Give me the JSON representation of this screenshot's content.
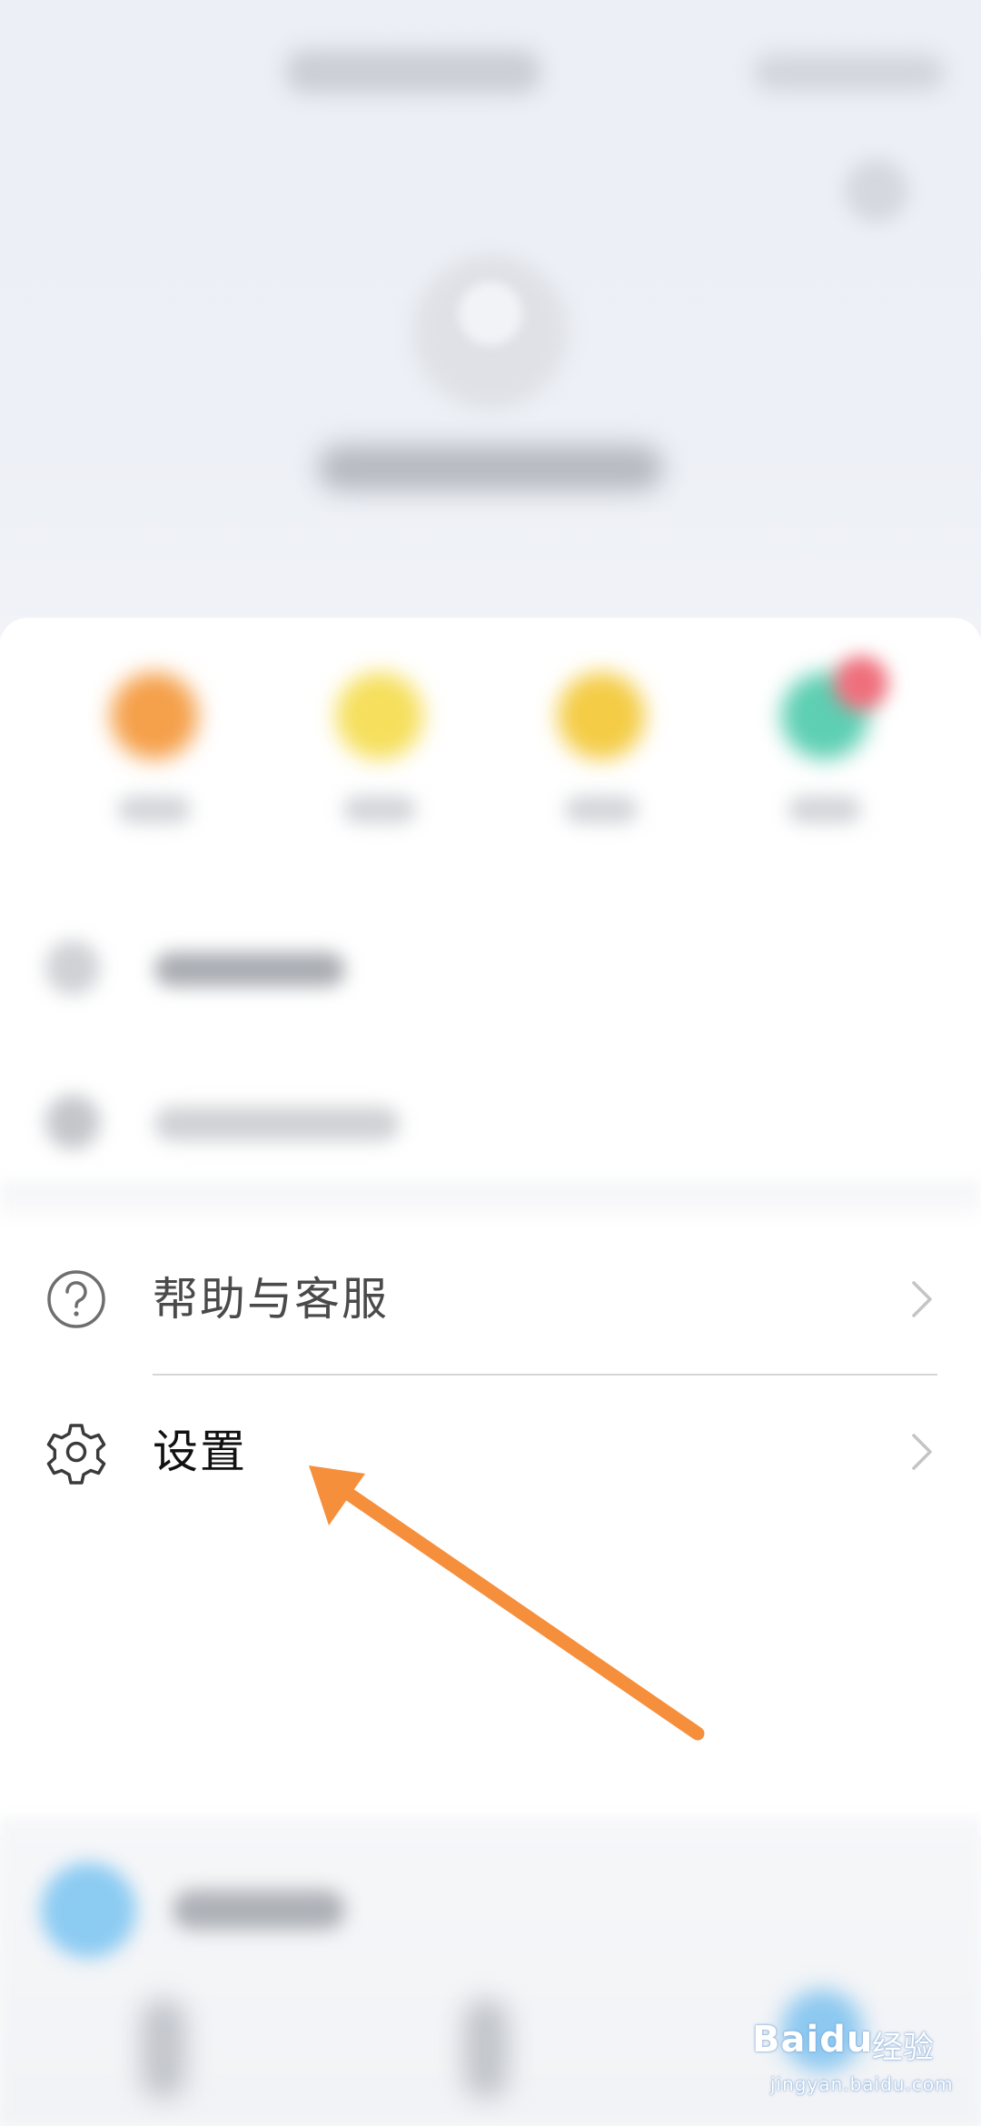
{
  "menu": {
    "help": {
      "label": "帮助与客服",
      "icon": "help-circle-icon"
    },
    "settings": {
      "label": "设置",
      "icon": "gear-icon"
    }
  },
  "quick_actions_colors": [
    "#f5a04a",
    "#f6df5c",
    "#f4cc45",
    "#5ecfb3"
  ],
  "annotation": {
    "arrow_color": "#f58f3c"
  },
  "watermark": {
    "brand": "Baidu",
    "text": "经验",
    "url": "jingyan.baidu.com"
  }
}
